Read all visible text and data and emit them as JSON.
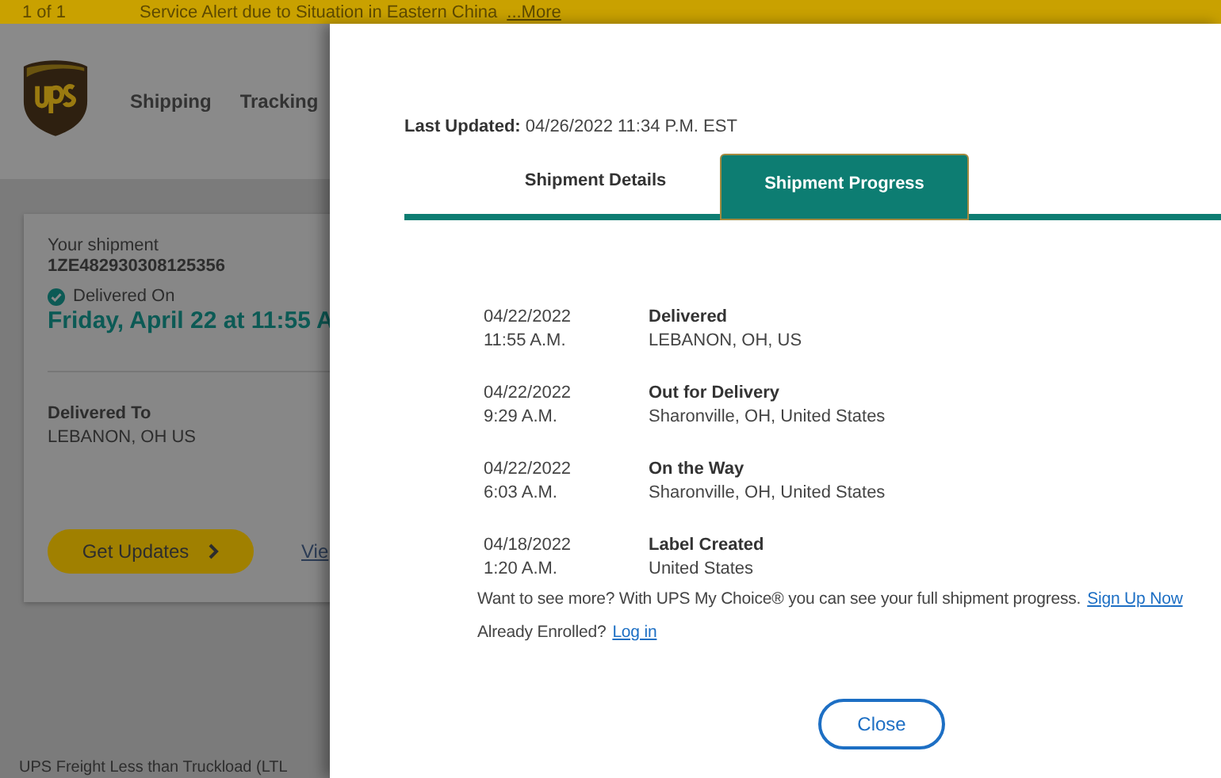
{
  "alert_bar": {
    "counter": "1 of 1",
    "message": "Service Alert due to Situation in Eastern China",
    "link": "...More"
  },
  "header": {
    "nav": [
      "Shipping",
      "Tracking"
    ]
  },
  "shipment_card": {
    "label": "Your shipment",
    "tracking_number": "1ZE482930308125356",
    "status": "Delivered On",
    "date_time": "Friday, April 22 at 11:55 A",
    "delivered_to_label": "Delivered To",
    "delivered_to": "LEBANON, OH US",
    "button": "Get Updates",
    "link": "Vie"
  },
  "footer_text": "UPS Freight Less than Truckload (LTL",
  "modal": {
    "last_updated": {
      "label": "Last Updated:",
      "value": "04/26/2022 11:34 P.M. EST"
    },
    "tabs": [
      {
        "label": "Shipment Details",
        "selected": false
      },
      {
        "label": "Shipment Progress",
        "selected": true
      }
    ],
    "events": [
      {
        "date": "04/22/2022",
        "time": "11:55 A.M.",
        "status": "Delivered",
        "location": "LEBANON, OH, US"
      },
      {
        "date": "04/22/2022",
        "time": "9:29 A.M.",
        "status": "Out for Delivery",
        "location": "Sharonville, OH, United States"
      },
      {
        "date": "04/22/2022",
        "time": "6:03 A.M.",
        "status": "On the Way",
        "location": "Sharonville, OH, United States"
      },
      {
        "date": "04/18/2022",
        "time": "1:20 A.M.",
        "status": "Label Created",
        "location": "United States"
      }
    ],
    "promo": {
      "text": "Want to see more? With UPS My Choice® you can see your full shipment progress.",
      "link": "Sign Up Now"
    },
    "enrolled": {
      "text": "Already Enrolled?",
      "link": "Log in"
    },
    "close_button": "Close"
  }
}
